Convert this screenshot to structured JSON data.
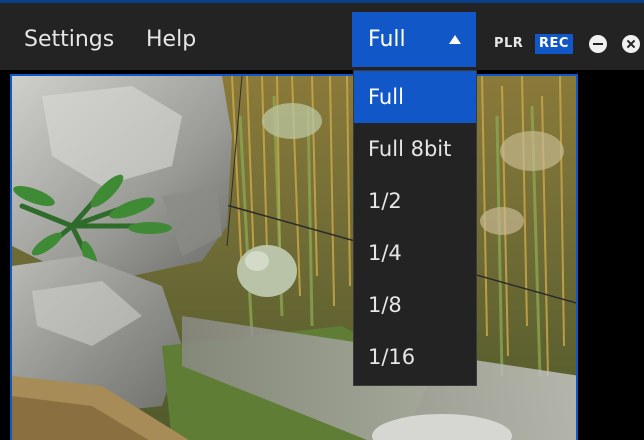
{
  "menubar": {
    "settings_label": "Settings",
    "help_label": "Help"
  },
  "quality_select": {
    "selected": "Full",
    "options": [
      "Full",
      "Full 8bit",
      "1/2",
      "1/4",
      "1/8",
      "1/16"
    ],
    "accent_color": "#1157c7"
  },
  "status": {
    "plr_label": "PLR",
    "rec_label": "REC"
  },
  "window_controls": {
    "minimize_icon": "minus-circle-icon",
    "close_icon": "x-circle-icon"
  },
  "viewport": {
    "content": "camera-preview-image"
  }
}
